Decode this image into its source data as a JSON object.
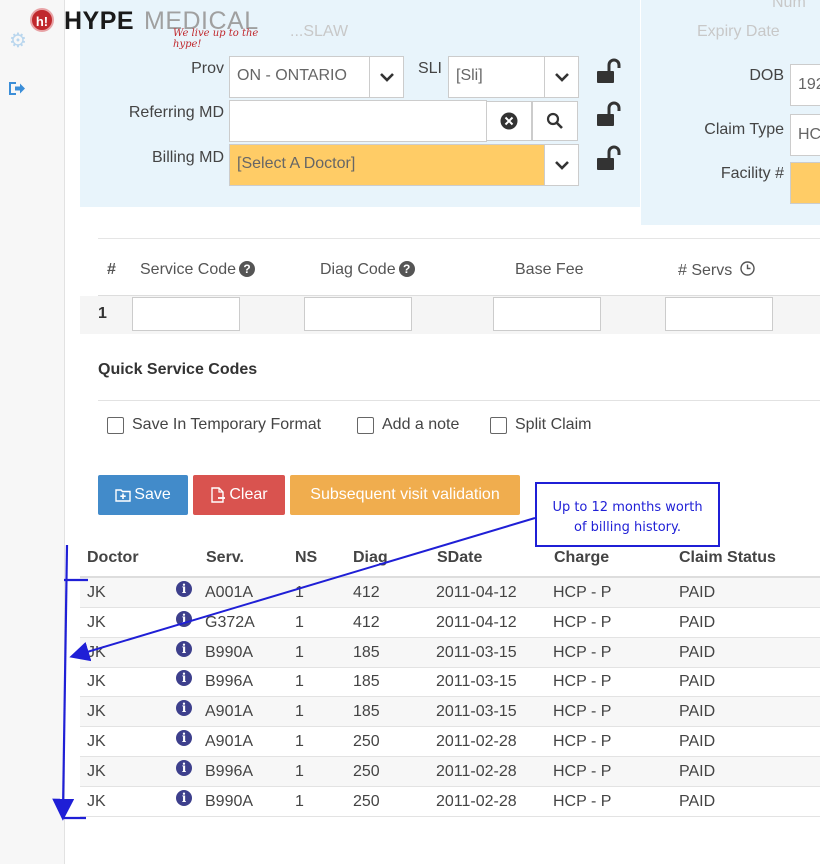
{
  "header": {
    "logo_badge": "h!",
    "logo_hype": "HYPE",
    "logo_medical": "MEDICAL",
    "tagline": "We live up to the hype!"
  },
  "sidebar": {
    "icons": [
      "gear-icon",
      "logout-icon"
    ]
  },
  "patient_form": {
    "ghost_name": "...SLAW",
    "ghost_num": "Num",
    "ghost_expiry": "Expiry Date",
    "prov_label": "Prov",
    "prov_value": "ON - ONTARIO",
    "sli_label": "SLI",
    "sli_value": "[Sli]",
    "referring_label": "Referring MD",
    "referring_value": "",
    "billing_label": "Billing MD",
    "billing_value": "[Select A Doctor]",
    "dob_label": "DOB",
    "dob_value": "192",
    "claim_type_label": "Claim Type",
    "claim_type_value": "HC",
    "facility_label": "Facility #",
    "facility_value": ""
  },
  "service_table": {
    "headers": [
      "#",
      "Service Code",
      "Diag Code",
      "Base Fee",
      "# Servs"
    ],
    "row_number": "1"
  },
  "quick_codes_title": "Quick Service Codes",
  "options": {
    "temp_format": "Save In Temporary Format",
    "add_note": "Add a note",
    "split_claim": "Split Claim"
  },
  "actions": {
    "save": "Save",
    "clear": "Clear",
    "subsequent": "Subsequent visit validation"
  },
  "colors": {
    "save": "#428bca",
    "clear": "#d9534f",
    "subsequent": "#f0ad4e",
    "billing_highlight": "#ffcc66",
    "annotation": "#1f1fd6"
  },
  "history": {
    "headers": [
      "Doctor",
      "Serv.",
      "NS",
      "Diag",
      "SDate",
      "Charge",
      "Claim Status"
    ],
    "rows": [
      [
        "JK",
        "A001A",
        "1",
        "412",
        "2011-04-12",
        "HCP - P",
        "PAID"
      ],
      [
        "JK",
        "G372A",
        "1",
        "412",
        "2011-04-12",
        "HCP - P",
        "PAID"
      ],
      [
        "JK",
        "B990A",
        "1",
        "185",
        "2011-03-15",
        "HCP - P",
        "PAID"
      ],
      [
        "JK",
        "B996A",
        "1",
        "185",
        "2011-03-15",
        "HCP - P",
        "PAID"
      ],
      [
        "JK",
        "A901A",
        "1",
        "185",
        "2011-03-15",
        "HCP - P",
        "PAID"
      ],
      [
        "JK",
        "A901A",
        "1",
        "250",
        "2011-02-28",
        "HCP - P",
        "PAID"
      ],
      [
        "JK",
        "B996A",
        "1",
        "250",
        "2011-02-28",
        "HCP - P",
        "PAID"
      ],
      [
        "JK",
        "B990A",
        "1",
        "250",
        "2011-02-28",
        "HCP - P",
        "PAID"
      ]
    ]
  },
  "annotation": {
    "line1": "Up to 12 months worth",
    "line2": "of billing history."
  }
}
